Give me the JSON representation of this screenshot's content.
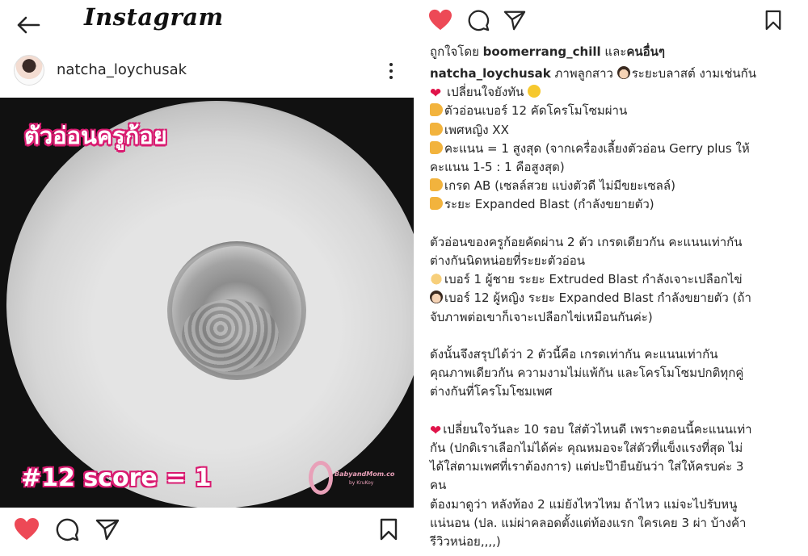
{
  "app": {
    "logo": "Instagram"
  },
  "post": {
    "author": "natcha_loychusak",
    "image": {
      "title_text": "ตัวอ่อนครูก้อย",
      "score_text": "#12 score = 1",
      "watermark_main": "BabyandMom.co",
      "watermark_sub": "by KruKoy"
    },
    "liked": true
  },
  "icons": {
    "back": "arrow-left-icon",
    "more": "more-vertical-icon",
    "like": "heart-icon",
    "comment": "comment-icon",
    "share": "send-icon",
    "save": "bookmark-icon"
  },
  "colors": {
    "like_red": "#ed4956",
    "overlay_pink": "#d91a70"
  },
  "caption": {
    "liked_prefix": "ถูกใจโดย",
    "liked_user": "boomerrang_chill",
    "liked_suffix": "และ",
    "liked_others": "คนอื่นๆ",
    "user": "natcha_loychusak",
    "lines": [
      "ภาพลูกสาว",
      "ระยะบลาสต์ งามเช่นกัน",
      "เปลี่ยนใจยังทัน",
      "ตัวอ่อนเบอร์ 12 คัดโครโมโซมผ่าน",
      "เพศหญิง XX",
      "คะแนน = 1 สูงสุด (จากเครื่องเลี้ยงตัวอ่อน Gerry plus ให้",
      "คะแนน 1-5 : 1 คือสูงสุด)",
      "เกรด AB (เซลล์สวย แบ่งตัวดี ไม่มีขยะเซลล์)",
      "ระยะ Expanded Blast (กำลังขยายตัว)",
      "ตัวอ่อนของครูก้อยคัดผ่าน 2 ตัว เกรดเดียวกัน คะแนนเท่ากัน",
      "ต่างกันนิดหน่อยที่ระยะตัวอ่อน",
      "เบอร์ 1 ผู้ชาย ระยะ Extruded Blast กำลังเจาะเปลือกไข่",
      "เบอร์ 12 ผู้หญิง ระยะ Expanded Blast กำลังขยายตัว (ถ้า",
      "จับภาพต่อเขาก็เจาะเปลือกไข่เหมือนกันค่ะ)",
      "ดังนั้นจึงสรุปได้ว่า 2 ตัวนี้คือ เกรดเท่ากัน คะแนนเท่ากัน",
      "คุณภาพเดียวกัน ความงามไม่แพ้กัน และโครโมโซมปกติทุกคู่",
      "ต่างกันที่โครโมโซมเพศ",
      "เปลี่ยนใจวันละ 10 รอบ ใส่ตัวไหนดี เพราะตอนนี้คะแนนเท่า",
      "กัน (ปกติเราเลือกไม่ได้ค่ะ คุณหมอจะใส่ตัวที่แข็งแรงที่สุด ไม่",
      "ได้ใส่ตามเพศที่เราต้องการ) แต่ปะป๊ายืนยันว่า ใส่ให้ครบค่ะ 3",
      "คน",
      "ต้องมาดูว่า หลังท้อง 2 แม่ยังไหวไหม ถ้าไหว แม่จะไปรับหนู",
      "แน่นอน (ปล. แม่ผ่าคลอดตั้งแต่ท้องแรก ใครเคย 3 ผ่า บ้างค้า",
      "รีวิวหน่อย,,,,)"
    ]
  }
}
